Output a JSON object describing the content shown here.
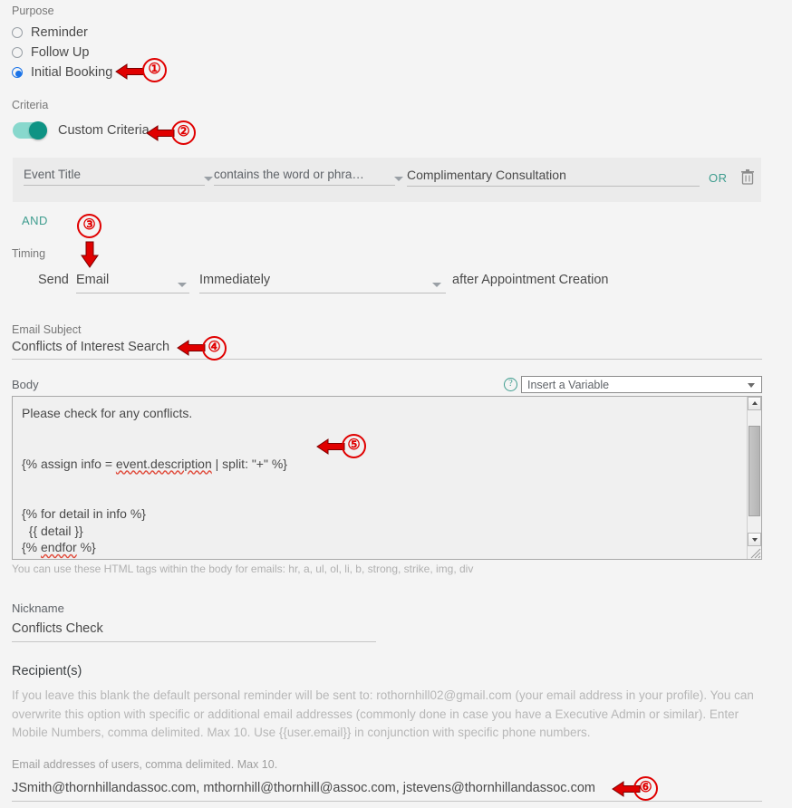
{
  "purpose": {
    "header": "Purpose",
    "options": [
      {
        "label": "Reminder",
        "selected": false
      },
      {
        "label": "Follow Up",
        "selected": false
      },
      {
        "label": "Initial Booking",
        "selected": true
      }
    ]
  },
  "criteria": {
    "header": "Criteria",
    "toggle_label": "Custom Criteria",
    "toggle_on": true,
    "row": {
      "field": "Event Title",
      "operator": "contains the word or phra…",
      "value": "Complimentary Consultation",
      "or_label": "OR",
      "delete_icon": "trash-icon"
    },
    "and_label": "AND"
  },
  "timing": {
    "header": "Timing",
    "send_label": "Send",
    "channel": "Email",
    "when": "Immediately",
    "suffix": "after Appointment Creation"
  },
  "email_subject": {
    "header": "Email Subject",
    "value": "Conflicts of Interest Search"
  },
  "body": {
    "header": "Body",
    "help_icon": "help-circle-icon",
    "variable_select": "Insert a Variable",
    "text_line1": "Please check for any conflicts.",
    "text_assign_prefix": "{% assign info = ",
    "text_assign_var": "event.description",
    "text_assign_suffix": " | split: \"+\" %}",
    "text_for": "{% for detail in info %}",
    "text_detail": "  {{ detail }}",
    "text_endfor_prefix": "{% ",
    "text_endfor_var": "endfor",
    "text_endfor_suffix": " %}",
    "html_hint": "You can use these HTML tags within the body for emails: hr, a, ul, ol, li, b, strong, strike, img, div"
  },
  "nickname": {
    "header": "Nickname",
    "value": "Conflicts Check"
  },
  "recipients": {
    "header": "Recipient(s)",
    "description": "If you leave this blank the default personal reminder will be sent to: rothornhill02@gmail.com (your email address in your profile). You can overwrite this option with specific or additional email addresses (commonly done in case you have a Executive Admin or similar). Enter Mobile Numbers, comma delimited. Max 10. Use {{user.email}} in conjunction with specific phone numbers.",
    "sub_label": "Email addresses of users, comma delimited. Max 10.",
    "value": "JSmith@thornhillandassoc.com, mthornhill@thornhill@assoc.com, jstevens@thornhillandassoc.com"
  },
  "annotations": {
    "color": "#e00000",
    "markers": [
      {
        "number": "①",
        "target": "initial-booking-radio"
      },
      {
        "number": "②",
        "target": "custom-criteria-toggle"
      },
      {
        "number": "③",
        "target": "timing-section"
      },
      {
        "number": "④",
        "target": "email-subject-input"
      },
      {
        "number": "⑤",
        "target": "body-textarea"
      },
      {
        "number": "⑥",
        "target": "recipient-emails-input"
      }
    ]
  }
}
